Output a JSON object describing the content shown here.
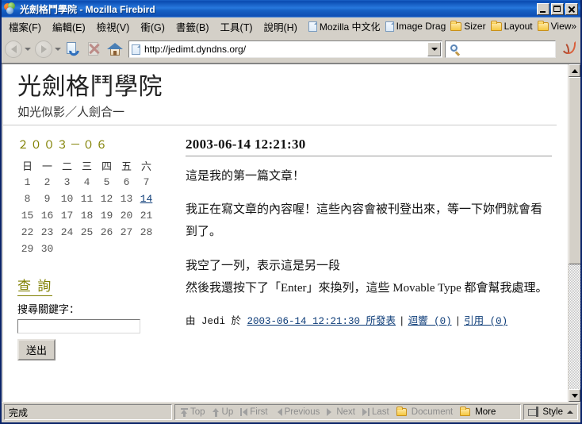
{
  "window": {
    "title": "光劍格鬥學院 - Mozilla Firebird",
    "minimize_label": "Minimize",
    "maximize_label": "Maximize",
    "close_label": "Close"
  },
  "menubar": {
    "items": [
      {
        "label": "檔案(F)"
      },
      {
        "label": "編輯(E)"
      },
      {
        "label": "檢視(V)"
      },
      {
        "label": "衝(G)"
      },
      {
        "label": "書籤(B)"
      },
      {
        "label": "工具(T)"
      },
      {
        "label": "說明(H)"
      }
    ],
    "bookmarks": [
      {
        "label": "Mozilla 中文化",
        "icon": "document-icon"
      },
      {
        "label": "Image Drag",
        "icon": "document-icon"
      },
      {
        "label": "Sizer",
        "icon": "folder-icon"
      },
      {
        "label": "Layout",
        "icon": "folder-icon"
      },
      {
        "label": "View»",
        "icon": "folder-icon"
      }
    ]
  },
  "toolbar": {
    "back_label": "Back",
    "forward_label": "Forward",
    "reload_label": "Reload",
    "stop_label": "Stop",
    "home_label": "Home",
    "url_value": "http://jedimt.dyndns.org/",
    "url_dropdown_label": "Go",
    "search_value": "",
    "search_placeholder": ""
  },
  "page": {
    "blog_title": "光劍格鬥學院",
    "blog_description": "如光似影／人劍合一",
    "calendar": {
      "title": "２００３－０６",
      "weekday_headers": [
        "日",
        "一",
        "二",
        "三",
        "四",
        "五",
        "六"
      ],
      "weeks": [
        [
          "",
          "",
          "",
          "",
          "",
          "",
          ""
        ],
        [
          "1",
          "2",
          "3",
          "4",
          "5",
          "6",
          "7"
        ],
        [
          "8",
          "9",
          "10",
          "11",
          "12",
          "13",
          "14"
        ],
        [
          "15",
          "16",
          "17",
          "18",
          "19",
          "20",
          "21"
        ],
        [
          "22",
          "23",
          "24",
          "25",
          "26",
          "27",
          "28"
        ],
        [
          "29",
          "30",
          "",
          "",
          "",
          "",
          ""
        ]
      ],
      "linked_days": [
        "14"
      ],
      "title_color": "#808000",
      "link_color": "#0d3c78"
    },
    "search": {
      "heading": "查 詢",
      "label": "搜尋關鍵字：",
      "input_value": "",
      "button_label": "送出"
    },
    "post": {
      "date_heading": "2003-06-14 12:21:30",
      "paragraphs": [
        "這是我的第一篇文章！",
        "我正在寫文章的內容喔！這些內容會被刊登出來，等一下妳們就會看到了。",
        "我空了一列，表示這是另一段\n然後我還按下了「Enter」來換列，這些 Movable Type 都會幫我處理。"
      ],
      "footer_prefix": "由 Jedi 於 ",
      "footer_date_link": "2003-06-14 12:21:30 所發表",
      "footer_sep1": "|",
      "footer_comments_link": "迴響 (0)",
      "footer_sep2": "|",
      "footer_trackback_link": "引用 (0)"
    }
  },
  "statusbar": {
    "status_text": "完成",
    "nav_links": [
      {
        "label": "Top",
        "icon": "arrow-up-bar-icon",
        "enabled": false
      },
      {
        "label": "Up",
        "icon": "arrow-up-icon",
        "enabled": false
      },
      {
        "label": "First",
        "icon": "arrow-first-icon",
        "enabled": false
      },
      {
        "label": "Previous",
        "icon": "arrow-left-icon",
        "enabled": false
      },
      {
        "label": "Next",
        "icon": "arrow-right-icon",
        "enabled": false
      },
      {
        "label": "Last",
        "icon": "arrow-last-icon",
        "enabled": false
      },
      {
        "label": "Document",
        "icon": "folder-icon",
        "enabled": false
      },
      {
        "label": "More",
        "icon": "folder-icon",
        "enabled": true
      }
    ],
    "style_label": "Style"
  }
}
